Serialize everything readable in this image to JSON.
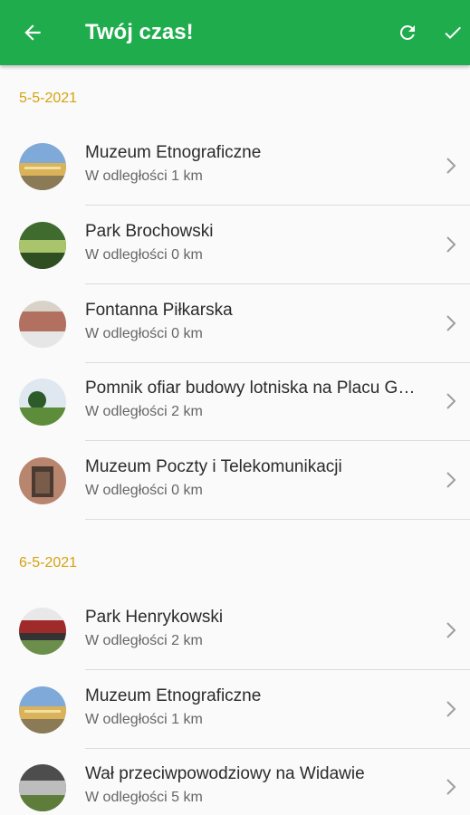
{
  "appbar": {
    "title": "Twój czas!",
    "back_icon": "arrow-back-icon",
    "refresh_icon": "refresh-icon",
    "check_icon": "check-icon",
    "color": "#1fac4c"
  },
  "sections": [
    {
      "date": "5-5-2021",
      "items": [
        {
          "name": "Muzeum Etnograficzne",
          "distance": "W odległości 1 km"
        },
        {
          "name": "Park Brochowski",
          "distance": "W odległości 0 km"
        },
        {
          "name": "Fontanna Piłkarska",
          "distance": "W odległości 0 km"
        },
        {
          "name": "Pomnik ofiar budowy lotniska na Placu G…",
          "distance": "W odległości 2 km"
        },
        {
          "name": "Muzeum Poczty i Telekomunikacji",
          "distance": "W odległości 0 km"
        }
      ]
    },
    {
      "date": "6-5-2021",
      "items": [
        {
          "name": "Park Henrykowski",
          "distance": "W odległości 2 km"
        },
        {
          "name": "Muzeum Etnograficzne",
          "distance": "W odległości 1 km"
        },
        {
          "name": "Wał przeciwpowodziowy na Widawie",
          "distance": "W odległości 5 km"
        }
      ]
    }
  ],
  "date_color": "#d6a20f"
}
